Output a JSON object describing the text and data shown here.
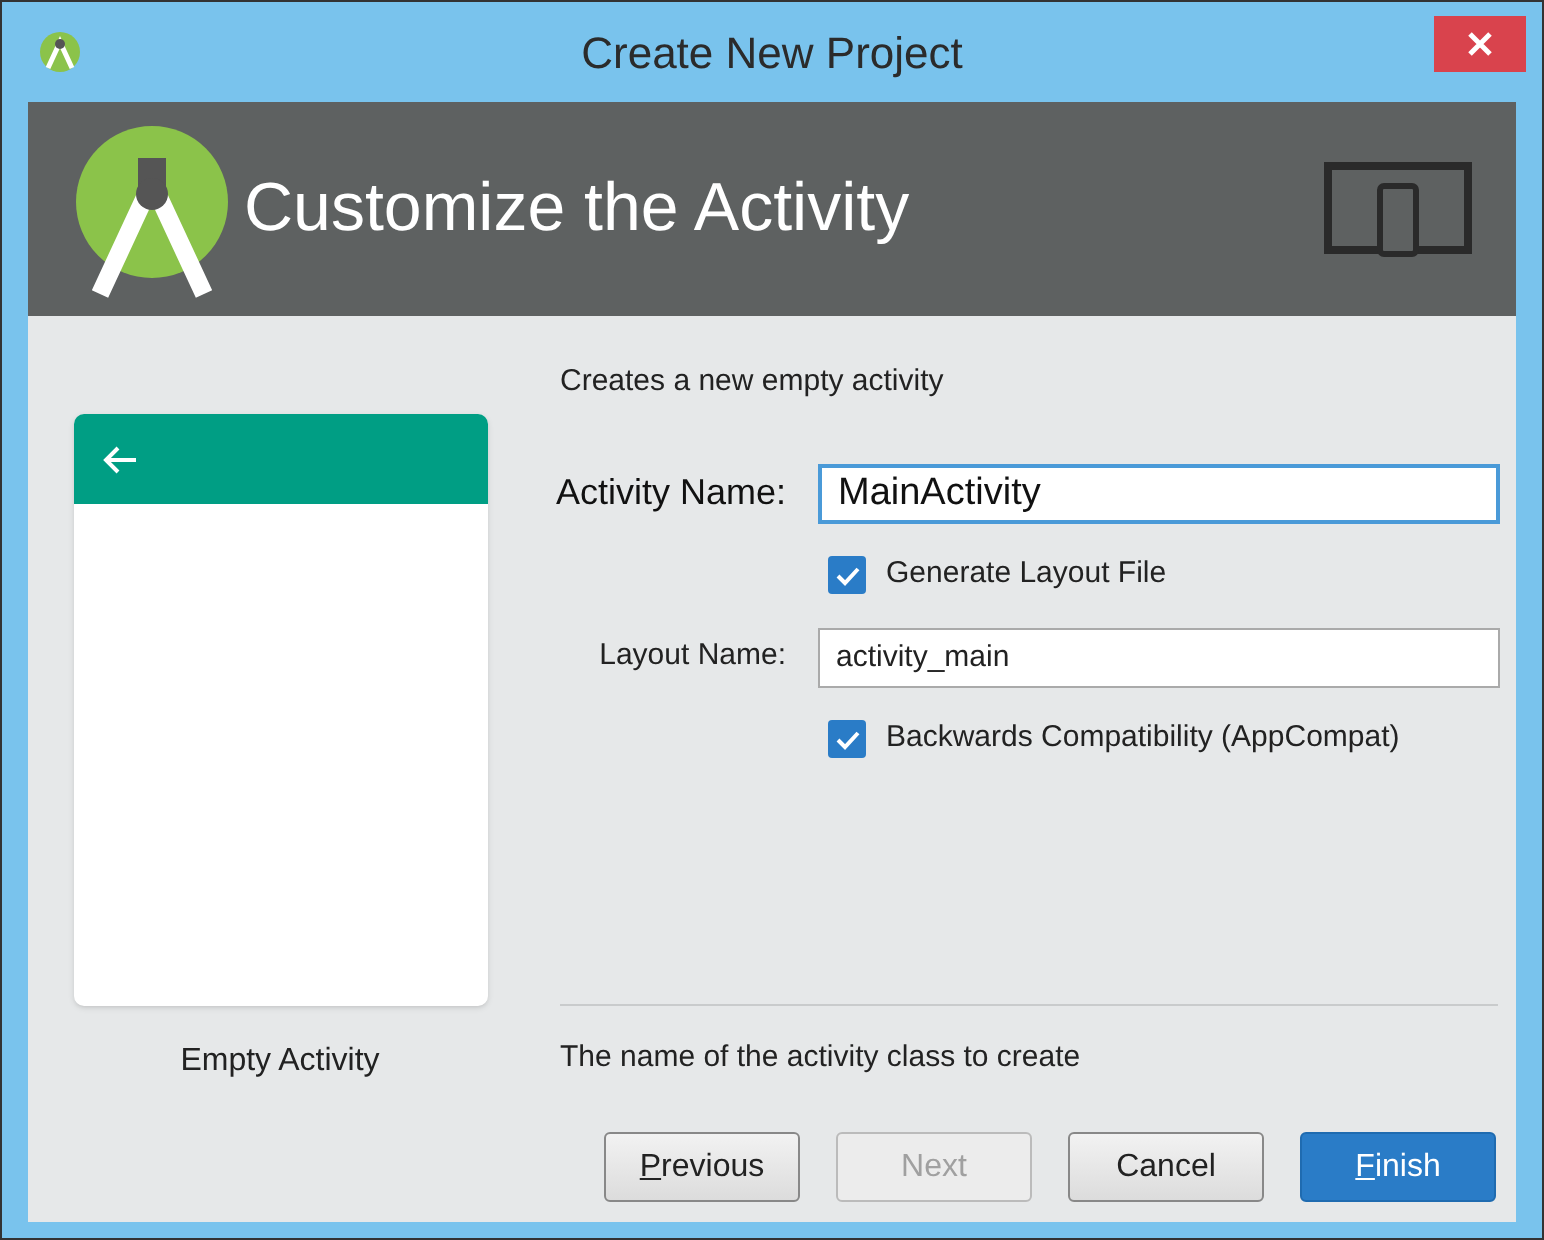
{
  "window": {
    "title": "Create New Project"
  },
  "header": {
    "title": "Customize the Activity"
  },
  "template": {
    "name": "Empty Activity"
  },
  "description": "Creates a new empty activity",
  "fields": [
    {
      "kind": "field",
      "label": "Activity Name:",
      "value": "MainActivity",
      "focused": true,
      "large": true
    },
    {
      "kind": "checkbox",
      "label": "Generate Layout File",
      "checked": true
    },
    {
      "kind": "field",
      "label": "Layout Name:",
      "value": "activity_main",
      "focused": false,
      "large": false
    },
    {
      "kind": "checkbox",
      "label": "Backwards Compatibility (AppCompat)",
      "checked": true
    }
  ],
  "hint": "The name of the activity class to create",
  "buttons": [
    {
      "mnemonic": "P",
      "rest": "revious",
      "disabled": false,
      "default": false
    },
    {
      "rest": "Next",
      "disabled": true,
      "default": false
    },
    {
      "rest": "Cancel",
      "disabled": false,
      "default": false
    },
    {
      "mnemonic": "F",
      "rest": "inish",
      "disabled": false,
      "default": true
    }
  ]
}
